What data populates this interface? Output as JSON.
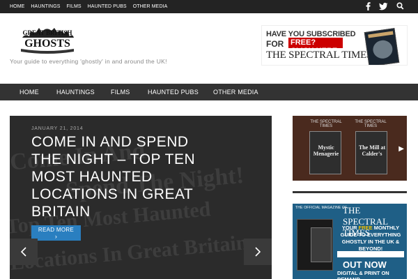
{
  "topbar": {
    "nav": [
      "HOME",
      "HAUNTINGS",
      "FILMS",
      "HAUNTED PUBS",
      "OTHER MEDIA"
    ],
    "icons": [
      "facebook-icon",
      "twitter-icon",
      "search-icon"
    ]
  },
  "header": {
    "logo_alt": "Great British Ghosts",
    "tagline": "Your guide to everything 'ghostly' in and around the UK!"
  },
  "ad": {
    "line1": "HAVE YOU SUBSCRIBED",
    "line2a": "FOR",
    "line2b": "FREE? CLICK HERE",
    "line3": "THE SPECTRAL TIMES"
  },
  "mainnav": [
    "HOME",
    "HAUNTINGS",
    "FILMS",
    "HAUNTED PUBS",
    "OTHER MEDIA"
  ],
  "slider": {
    "date": "JANUARY 21, 2014",
    "headline": "COME IN AND SPEND THE NIGHT – TOP TEN MOST HAUNTED LOCATIONS IN GREAT BRITAIN",
    "read_more": "READ MORE",
    "bg_lines": [
      "Come In And",
      "Spend The Night!",
      "Top Ten Most Haunted",
      "Locations In Great Britain"
    ]
  },
  "sidebar": {
    "widget1_caption": "THE SPECTRAL TIMES",
    "book1": "Mystic Menagerie",
    "book2": "The Mill at Calder's",
    "widget2": {
      "official": "THE OFFICIAL MAGAZINE OF",
      "masthead": "THE SPECTRAL TIMES",
      "blurb_pre": "YOUR",
      "blurb_free": "FREE",
      "blurb_post": "MONTHLY GUIDE TO EVERYTHING GHOSTLY IN THE UK & BEYOND!",
      "out_now": "OUT NOW",
      "digital": "DIGITAL & PRINT ON DEMAND"
    }
  },
  "colors": {
    "topbar": "#232323",
    "mainnav": "#333333",
    "accent": "#2a7fc0"
  }
}
